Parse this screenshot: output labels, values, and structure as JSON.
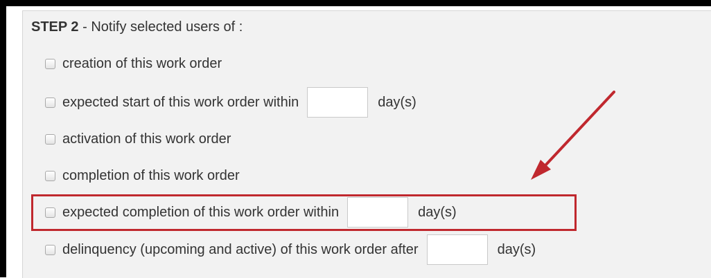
{
  "step": {
    "label": "STEP 2",
    "separator": " - ",
    "text": "Notify selected users of :"
  },
  "options": [
    {
      "label": "creation of this work order"
    },
    {
      "label": "expected start of this work order within",
      "input_value": "",
      "suffix": "day(s)"
    },
    {
      "label": "activation of this work order"
    },
    {
      "label": "completion of this work order"
    },
    {
      "label": "expected completion of this work order within",
      "input_value": "",
      "suffix": "day(s)",
      "highlighted": true
    },
    {
      "label": "delinquency (upcoming and active) of this work order after",
      "input_value": "",
      "suffix": "day(s)"
    }
  ],
  "annotation": {
    "color": "#c0282e"
  }
}
